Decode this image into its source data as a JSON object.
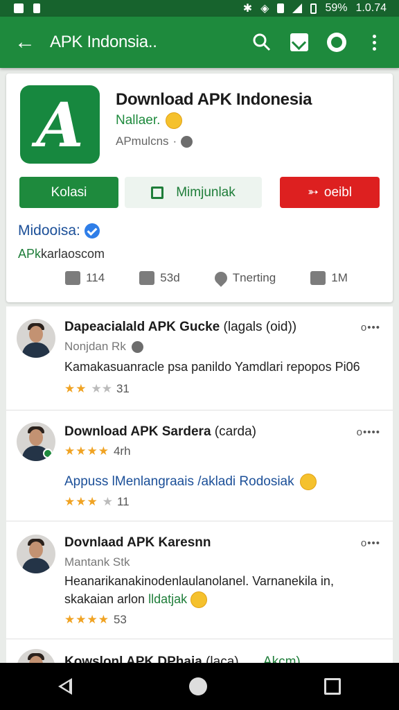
{
  "status_bar": {
    "battery": "59%",
    "time": "1.0.74"
  },
  "app_bar": {
    "title": "APK Indonsia.."
  },
  "app": {
    "title": "Download APK Indonesia",
    "developer": "Nallaer.",
    "meta": "APmulcns",
    "meta_sep": "·",
    "install_label": "Kolasi",
    "wishlist_label": "Mimjunlak",
    "share_label": "oeibl",
    "dev_name": "Midooisa:",
    "dev_site_prefix": "APk",
    "dev_site_rest": "karlaoscom",
    "stats": [
      {
        "icon": "thumbs-up-icon",
        "value": "114"
      },
      {
        "icon": "comment-icon",
        "value": "53d"
      },
      {
        "icon": "heart-icon",
        "value": "Tnerting"
      },
      {
        "icon": "thumbs-up-icon",
        "value": "1M"
      }
    ]
  },
  "reviews": [
    {
      "title": "Dapeacialald APK Gucke",
      "title_suffix": "(lagals (oid))",
      "menu": "o•••",
      "subtitle": "Nonjdan Rk",
      "text": "Kamakasuanracle psa panildo Yamdlari repopos Pi06",
      "rating_stars": "★★",
      "rating_empty": "★★",
      "rating_count": "31"
    },
    {
      "title": "Download APK Sardera",
      "title_suffix": "(carda)",
      "menu": "o••••",
      "rating_stars": "★★★★",
      "rating_empty": "",
      "rating_count": "4rh",
      "link_text": "Appuss lMenlangraais /akladi Rodosiak",
      "rating2_stars": "★★★",
      "rating2_empty": "★",
      "rating2_count": "11"
    },
    {
      "title": "Dovnlaad APK Karesnn",
      "title_suffix": "",
      "menu": "o•••",
      "subtitle": "Mantank Stk",
      "text": "Heanarikanakinodenlaulanolanel. Varnanekila in,",
      "text2_prefix": "skakaian arlon",
      "text2_link": "lldatjak",
      "rating_stars": "★★★★",
      "rating_empty": "",
      "rating_count": "53"
    },
    {
      "title": "Kowslonl APK DPhaia",
      "title_suffix": "(laca)",
      "link_tail": "Akcm)"
    }
  ],
  "colors": {
    "primary": "#1e8a3d",
    "primary_dark": "#17632d",
    "share_red": "#dd2020",
    "link_blue": "#1b4f98"
  }
}
